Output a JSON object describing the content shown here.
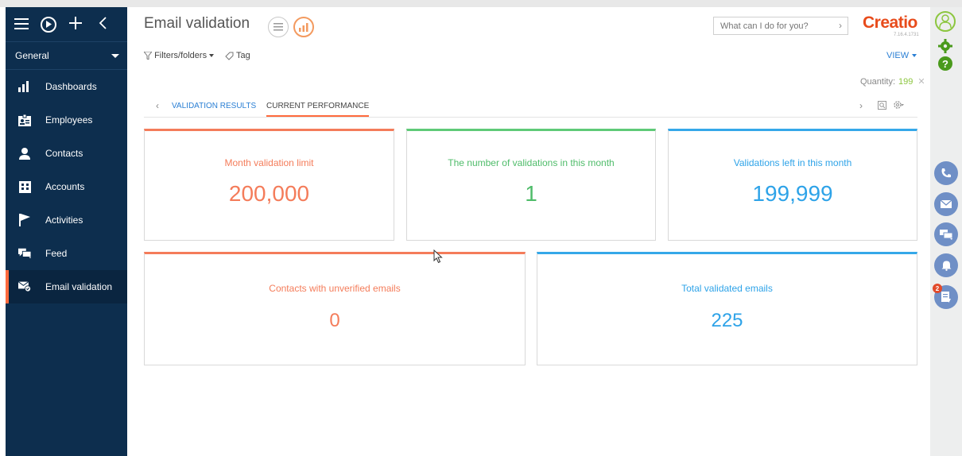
{
  "sidebar": {
    "workspace": "General",
    "items": [
      {
        "label": "Dashboards",
        "icon": "bar-chart-icon"
      },
      {
        "label": "Employees",
        "icon": "id-card-icon"
      },
      {
        "label": "Contacts",
        "icon": "person-icon"
      },
      {
        "label": "Accounts",
        "icon": "building-icon"
      },
      {
        "label": "Activities",
        "icon": "flag-icon"
      },
      {
        "label": "Feed",
        "icon": "chat-icon"
      },
      {
        "label": "Email validation",
        "icon": "email-check-icon",
        "active": true
      }
    ]
  },
  "header": {
    "title": "Email validation",
    "search_placeholder": "What can I do for you?",
    "logo": "Creatio",
    "version": "7.16.4.1731"
  },
  "toolbar": {
    "filters_label": "Filters/folders",
    "tag_label": "Tag",
    "view_label": "VIEW",
    "quantity_label": "Quantity:",
    "quantity_value": "199"
  },
  "tabs": [
    {
      "label": "VALIDATION RESULTS"
    },
    {
      "label": "CURRENT PERFORMANCE",
      "active": true
    }
  ],
  "tiles": [
    {
      "title": "Month validation limit",
      "value": "200,000",
      "color": "#f47c5a"
    },
    {
      "title": "The number of validations in this month",
      "value": "1",
      "color": "#4fbc6a"
    },
    {
      "title": "Validations left in this month",
      "value": "199,999",
      "color": "#2ea3e8"
    },
    {
      "title": "Contacts with unverified emails",
      "value": "0",
      "color": "#f47c5a"
    },
    {
      "title": "Total validated emails",
      "value": "225",
      "color": "#2ea3e8"
    }
  ],
  "right_panel": {
    "notification_count": "2"
  },
  "colors": {
    "sidebar_bg": "#0d2e4e",
    "accent": "#ff6a3d",
    "link": "#2a7fd4"
  }
}
